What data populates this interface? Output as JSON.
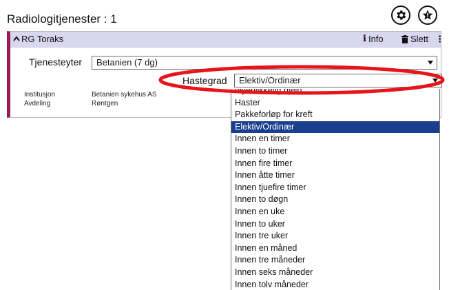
{
  "page": {
    "title": "Radiologitjenester : 1"
  },
  "top_icons": [
    {
      "name": "settings",
      "icon": "gear-icon"
    },
    {
      "name": "favorite",
      "icon": "star-badge-icon"
    }
  ],
  "panel": {
    "title": "RG Toraks",
    "accent_color": "#9c1a55",
    "header_color": "#d9d6f0",
    "actions": {
      "info": "Info",
      "delete": "Slett",
      "more": "⋮"
    }
  },
  "form": {
    "tjenesteyter": {
      "label": "Tjenesteyter",
      "value": "Betanien (7 dg)"
    },
    "hastegrad": {
      "label": "Hastegrad",
      "value": "Elektiv/Ordinær"
    },
    "institusjon": {
      "label": "Institusjon",
      "value": "Betanien sykehus AS"
    },
    "avdeling": {
      "label": "Avdeling",
      "value": "Røntgen"
    }
  },
  "dropdown": {
    "selected": "Elektiv/Ordinær",
    "options": [
      "Øyeblikkelig hjelp",
      "Haster",
      "Pakkeforløp for kreft",
      "Elektiv/Ordinær",
      "Innen en timer",
      "Innen to timer",
      "Innen fire timer",
      "Innen åtte timer",
      "Innen tjuefire timer",
      "Innen to døgn",
      "Innen en uke",
      "Innen to uker",
      "Innen tre uker",
      "Innen en måned",
      "Innen tre måneder",
      "Innen seks måneder",
      "Innen tolv måneder"
    ]
  },
  "annotation": {
    "color": "#e8141b"
  }
}
